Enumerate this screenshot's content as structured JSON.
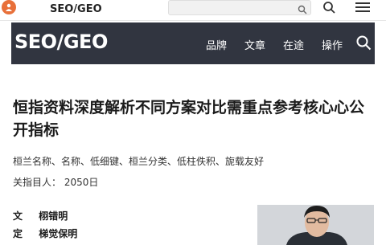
{
  "topbar": {
    "brand": "SEO/GEO",
    "search_placeholder": ""
  },
  "navbar": {
    "brand": "SEO/GEO",
    "items": [
      "品牌",
      "文章",
      "在途",
      "操作"
    ]
  },
  "article": {
    "title": "恒指资料深度解析不同方案对比需重点参考核心心公开指标",
    "tags": "桓兰名称、名称、低细键、桓兰分类、低柱佚积、旎载友好",
    "author_line": "关指目人： 2050日",
    "meta": [
      {
        "k": "文",
        "v": "栩错明"
      },
      {
        "k": "定",
        "v": "梯觉保明"
      }
    ]
  },
  "colors": {
    "logo": "#e8703a",
    "navbar_bg": "#313540"
  }
}
